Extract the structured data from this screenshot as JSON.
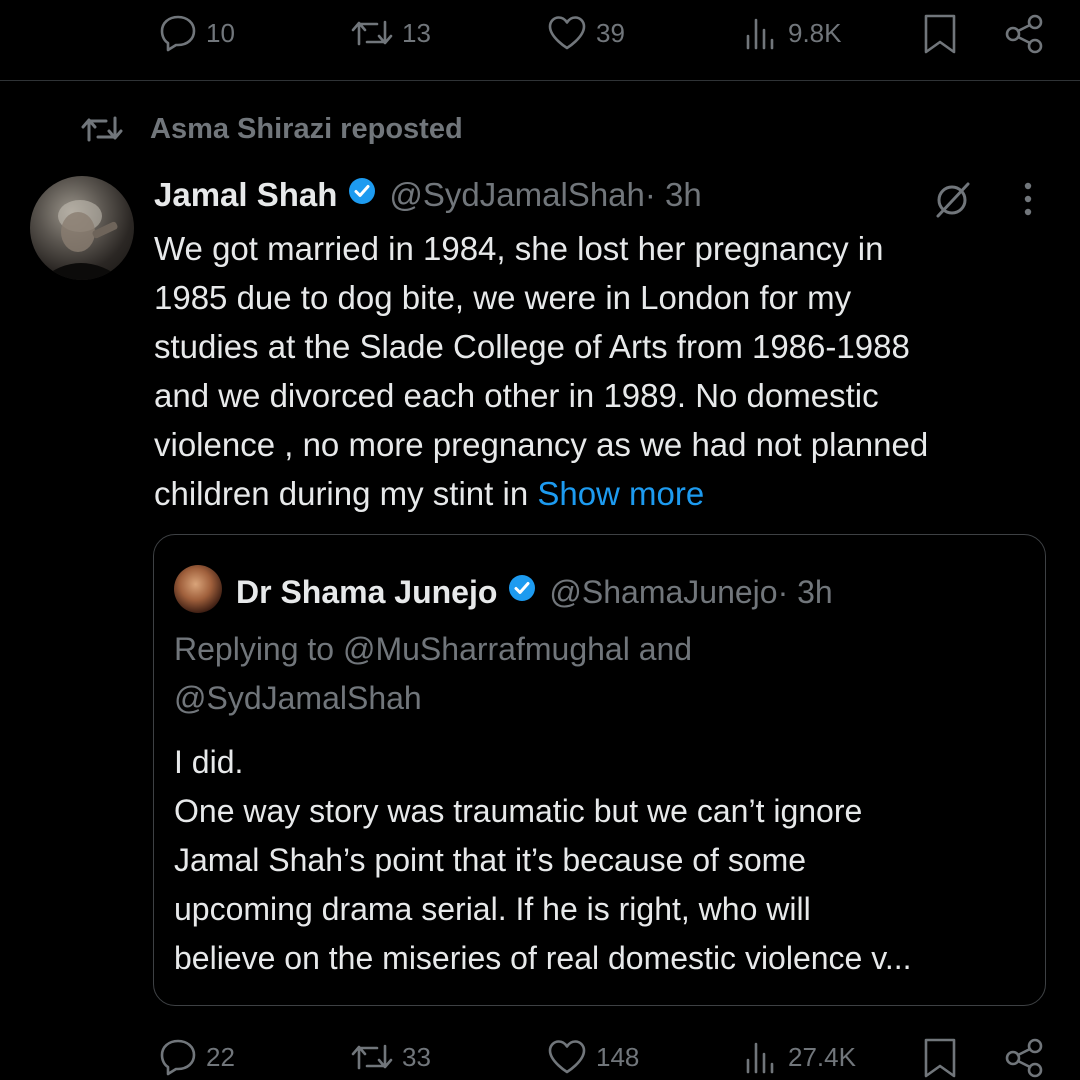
{
  "top_actions": {
    "replies": "10",
    "reposts": "13",
    "likes": "39",
    "views": "9.8K"
  },
  "repost_banner": {
    "text": "Asma Shirazi reposted"
  },
  "tweet": {
    "author_name": "Jamal Shah",
    "handle": "@SydJamalShah",
    "time": " · 3h",
    "text_lines": [
      "We got married in 1984, she lost her pregnancy in",
      "1985 due to dog bite, we were in London for my",
      "studies at the Slade College of Arts from 1986-1988",
      "and we  divorced each other in 1989. No domestic",
      "violence , no more pregnancy as we had not planned"
    ],
    "last_line": "children during my stint in ",
    "show_more": "Show more"
  },
  "quote": {
    "author_name": "Dr Shama Junejo",
    "handle": "@ShamaJunejo",
    "time": " · 3h",
    "replying_to_line1": "Replying to @MuSharrafmughal and",
    "replying_to_line2": "@SydJamalShah",
    "text_lines": [
      "I did.",
      "One way story was traumatic but we can’t ignore",
      "Jamal Shah’s point that it’s because of some",
      "upcoming drama serial. If he is right, who will",
      "believe on the miseries of real domestic violence v..."
    ]
  },
  "bottom_actions": {
    "replies": "22",
    "reposts": "33",
    "likes": "148",
    "views": "27.4K"
  },
  "colors": {
    "background": "#000000",
    "text": "#e7e9ea",
    "muted": "#71767b",
    "link": "#1d9bf0",
    "verified": "#1d9bf0"
  }
}
